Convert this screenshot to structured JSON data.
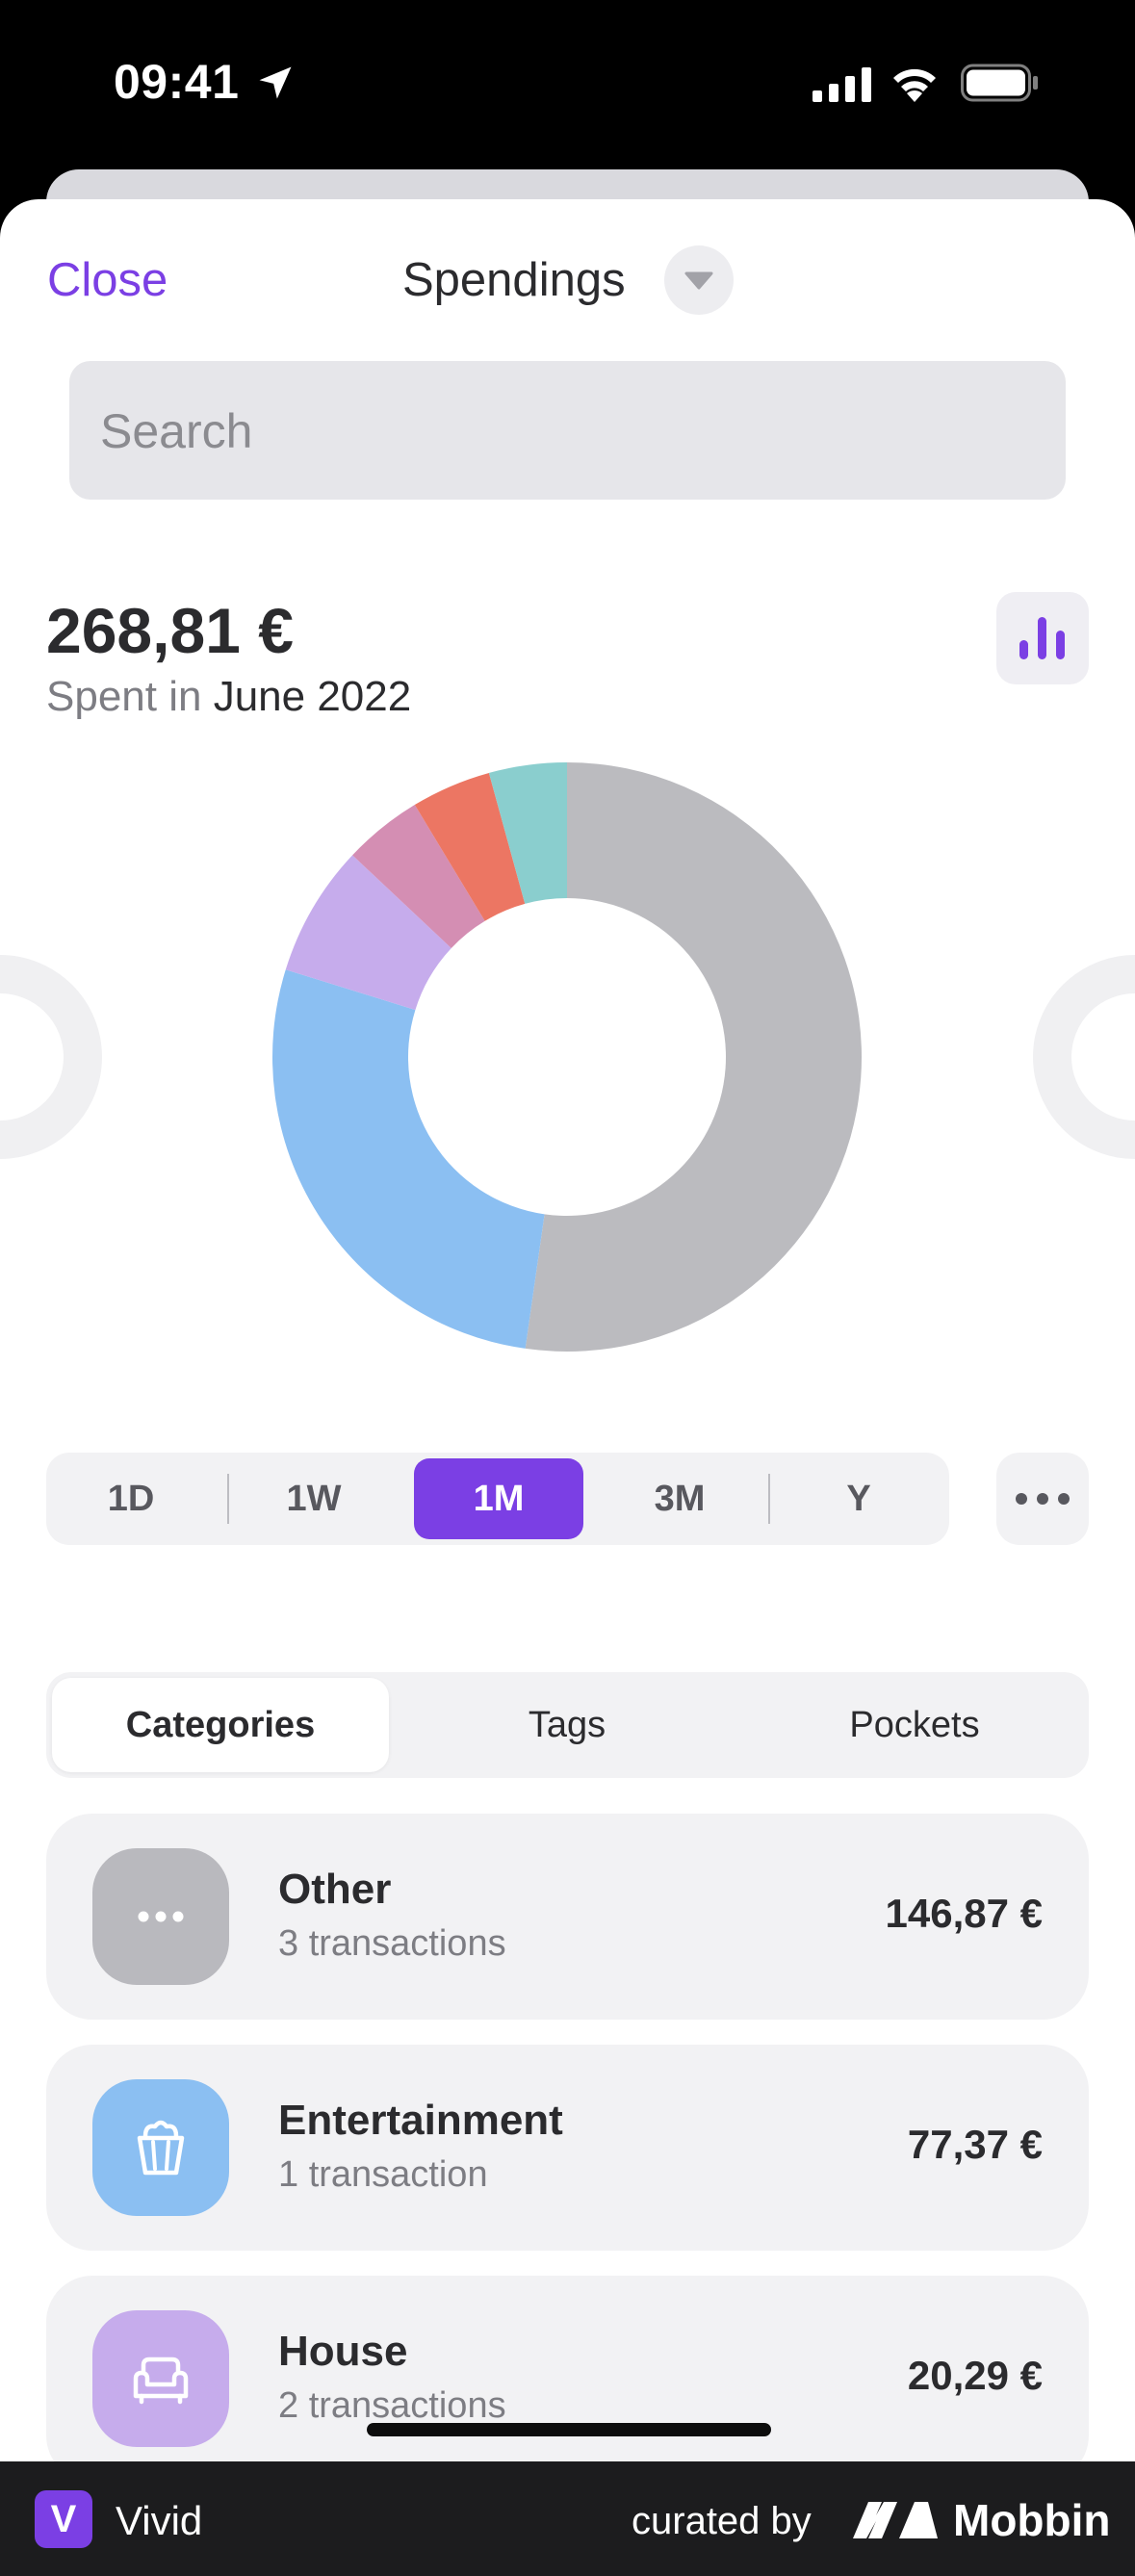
{
  "status_bar": {
    "time": "09:41"
  },
  "header": {
    "close_label": "Close",
    "title": "Spendings"
  },
  "search": {
    "placeholder": "Search"
  },
  "summary": {
    "amount": "268,81 €",
    "prefix": "Spent in",
    "period": "June 2022"
  },
  "chart_data": {
    "type": "pie",
    "variant": "donut",
    "slices": [
      {
        "label": "Other",
        "value": 146.87,
        "color": "#bbbbbf"
      },
      {
        "label": "Entertainment",
        "value": 77.37,
        "color": "#8bbff2"
      },
      {
        "label": "House",
        "value": 20.29,
        "color": "#c6acec"
      },
      {
        "label": "",
        "value": 12.2,
        "color": "#d48eb3"
      },
      {
        "label": "",
        "value": 12.3,
        "color": "#ec7663"
      },
      {
        "label": "",
        "value": 12.0,
        "color": "#8acece"
      }
    ]
  },
  "time_range": {
    "options": [
      "1D",
      "1W",
      "1M",
      "3M",
      "Y"
    ],
    "selected": "1M"
  },
  "tabs": {
    "items": [
      "Categories",
      "Tags",
      "Pockets"
    ],
    "selected": "Categories"
  },
  "categories": [
    {
      "name": "Other",
      "transactions": "3 transactions",
      "amount": "146,87 €",
      "color": "#b9b9be",
      "icon": "more-icon"
    },
    {
      "name": "Entertainment",
      "transactions": "1 transaction",
      "amount": "77,37 €",
      "color": "#8bbff2",
      "icon": "popcorn-icon"
    },
    {
      "name": "House",
      "transactions": "2 transactions",
      "amount": "20,29 €",
      "color": "#c6acec",
      "icon": "sofa-icon"
    }
  ],
  "footer": {
    "app_letter": "V",
    "app_name": "Vivid",
    "curated_by": "curated by",
    "brand": "Mobbin"
  }
}
